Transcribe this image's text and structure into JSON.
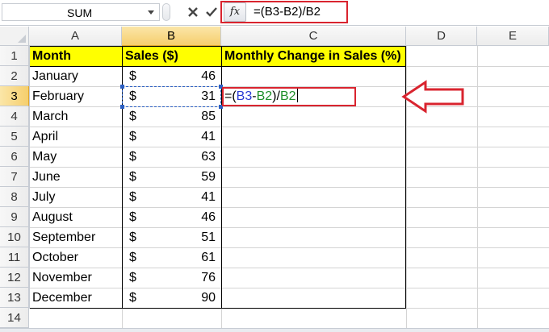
{
  "name_box": {
    "value": "SUM"
  },
  "formula_bar": {
    "fx_label": "fx",
    "formula": "=(B3-B2)/B2"
  },
  "columns": [
    "A",
    "B",
    "C",
    "D",
    "E"
  ],
  "rows": [
    "1",
    "2",
    "3",
    "4",
    "5",
    "6",
    "7",
    "8",
    "9",
    "10",
    "11",
    "12",
    "13",
    "14"
  ],
  "header": {
    "month": "Month",
    "sales": "Sales ($)",
    "change": "Monthly Change in Sales (%)"
  },
  "currency_symbol": "$",
  "data": [
    {
      "month": "January",
      "sales": "46"
    },
    {
      "month": "February",
      "sales": "31"
    },
    {
      "month": "March",
      "sales": "85"
    },
    {
      "month": "April",
      "sales": "41"
    },
    {
      "month": "May",
      "sales": "63"
    },
    {
      "month": "June",
      "sales": "59"
    },
    {
      "month": "July",
      "sales": "41"
    },
    {
      "month": "August",
      "sales": "46"
    },
    {
      "month": "September",
      "sales": "51"
    },
    {
      "month": "October",
      "sales": "61"
    },
    {
      "month": "November",
      "sales": "76"
    },
    {
      "month": "December",
      "sales": "90"
    }
  ],
  "edit_cell": {
    "eq": "=(",
    "ref1": "B3",
    "minus": "-",
    "ref2": "B2",
    "close": ")/",
    "ref3": "B2"
  },
  "colors": {
    "header_fill": "#ffff00",
    "highlight_red": "#d9242f",
    "ref_blue": "#2b3bd4",
    "ref_green": "#1f8f2a"
  }
}
